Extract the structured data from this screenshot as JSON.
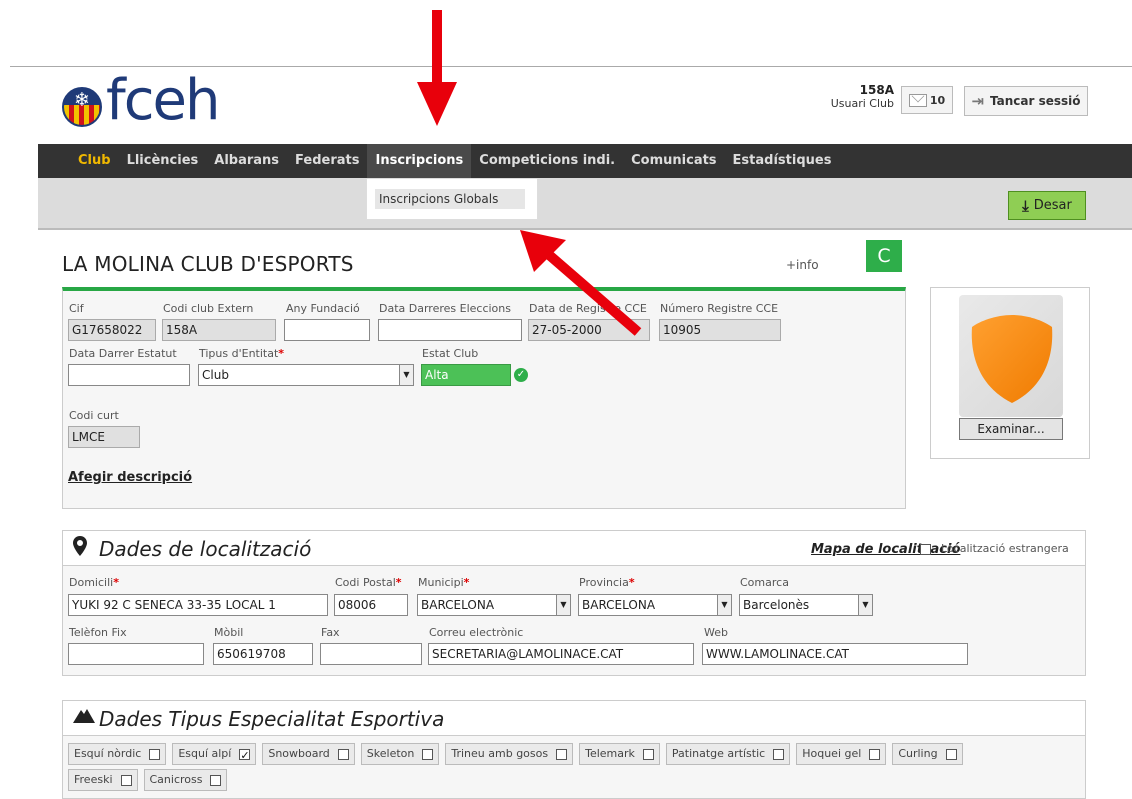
{
  "header": {
    "logo_text": "fceh",
    "user_code": "158A",
    "user_role": "Usuari Club",
    "message_count": "10",
    "logout_label": "Tancar sessió"
  },
  "nav": {
    "items": [
      "Club",
      "Llicències",
      "Albarans",
      "Federats",
      "Inscripcions",
      "Competicions indi.",
      "Comunicats",
      "Estadístiques"
    ],
    "active_item": "Club",
    "open_item": "Inscripcions",
    "dropdown_items": [
      "Inscripcions Globals"
    ]
  },
  "toolbar": {
    "save_label": "Desar"
  },
  "club": {
    "name": "LA MOLINA CLUB D'ESPORTS",
    "info_link": "+info",
    "badge": "C",
    "fields": {
      "cif": {
        "label": "Cif",
        "value": "G17658022"
      },
      "codi_extern": {
        "label": "Codi club Extern",
        "value": "158A"
      },
      "any_fundacio": {
        "label": "Any Fundació",
        "value": ""
      },
      "data_eleccions": {
        "label": "Data Darreres Eleccions",
        "value": ""
      },
      "data_registre": {
        "label": "Data de Registre CCE",
        "value": "27-05-2000"
      },
      "numero_registre": {
        "label": "Número Registre CCE",
        "value": "10905"
      },
      "data_estatut": {
        "label": "Data Darrer Estatut",
        "value": ""
      },
      "tipus_entitat": {
        "label": "Tipus d'Entitat",
        "value": "Club"
      },
      "estat_club": {
        "label": "Estat Club",
        "value": "Alta"
      },
      "codi_curt": {
        "label": "Codi curt",
        "value": "LMCE"
      }
    },
    "add_description": "Afegir descripció",
    "browse_label": "Examinar..."
  },
  "location": {
    "title": "Dades de localització",
    "map_link": "Mapa de localització",
    "foreign_label": "Localització estrangera",
    "fields": {
      "domicili": {
        "label": "Domicili",
        "value": "YUKI 92 C SENECA 33-35 LOCAL 1"
      },
      "codi_postal": {
        "label": "Codi Postal",
        "value": "08006"
      },
      "municipi": {
        "label": "Municipi",
        "value": "BARCELONA"
      },
      "provincia": {
        "label": "Provincia",
        "value": "BARCELONA"
      },
      "comarca": {
        "label": "Comarca",
        "value": "Barcelonès"
      },
      "telefon": {
        "label": "Telèfon Fix",
        "value": ""
      },
      "mobil": {
        "label": "Mòbil",
        "value": "650619708"
      },
      "fax": {
        "label": "Fax",
        "value": ""
      },
      "correu": {
        "label": "Correu electrònic",
        "value": "SECRETARIA@LAMOLINACE.CAT"
      },
      "web": {
        "label": "Web",
        "value": "WWW.LAMOLINACE.CAT"
      }
    }
  },
  "specialties": {
    "title": "Dades Tipus Especialitat Esportiva",
    "row1": [
      {
        "label": "Esquí nòrdic",
        "checked": false
      },
      {
        "label": "Esquí alpí",
        "checked": true
      },
      {
        "label": "Snowboard",
        "checked": false
      },
      {
        "label": "Skeleton",
        "checked": false
      },
      {
        "label": "Trineu amb gosos",
        "checked": false
      },
      {
        "label": "Telemark",
        "checked": false
      },
      {
        "label": "Patinatge artístic",
        "checked": false
      },
      {
        "label": "Hoquei gel",
        "checked": false
      },
      {
        "label": "Curling",
        "checked": false
      }
    ],
    "row2": [
      {
        "label": "Freeski",
        "checked": false
      },
      {
        "label": "Canicross",
        "checked": false
      }
    ]
  },
  "colors": {
    "accent_green": "#2eae4a",
    "nav_bg": "#333333",
    "nav_active": "#f0b800",
    "annotation_red": "#e8000b"
  }
}
